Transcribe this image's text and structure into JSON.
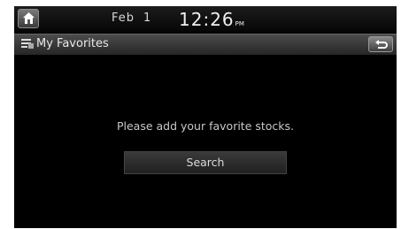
{
  "status_bar": {
    "home_icon": "home-icon",
    "date_month": "Feb",
    "date_day": "1",
    "time": "12:26",
    "ampm": "PM"
  },
  "title_bar": {
    "icon": "favorites-list-icon",
    "title": "My Favorites",
    "back_icon": "back-arrow-icon"
  },
  "main": {
    "message": "Please add your favorite stocks.",
    "search_label": "Search"
  },
  "colors": {
    "background": "#000000",
    "status_bar": "#111111",
    "title_bar": "#3a3a3a",
    "text": "#d0d0d0"
  }
}
